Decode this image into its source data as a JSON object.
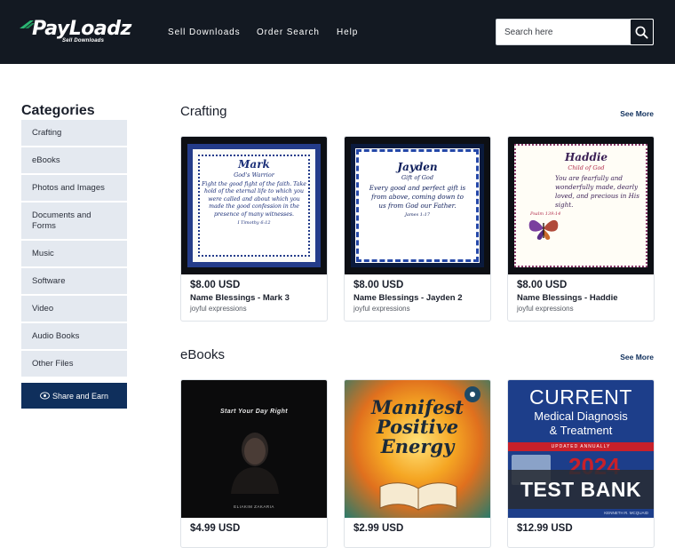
{
  "header": {
    "logo_text": "PayLoadz",
    "logo_sub": "Sell Downloads",
    "nav": [
      "Sell Downloads",
      "Order Search",
      "Help"
    ],
    "search_placeholder": "Search here"
  },
  "sidebar": {
    "title": "Categories",
    "items": [
      "Crafting",
      "eBooks",
      "Photos and Images",
      "Documents and Forms",
      "Music",
      "Software",
      "Video",
      "Audio Books",
      "Other Files"
    ],
    "share_label": "Share and Earn"
  },
  "sections": [
    {
      "title": "Crafting",
      "see_more": "See More",
      "cards": [
        {
          "price": "$8.00 USD",
          "name": "Name Blessings - Mark 3",
          "seller": "joyful expressions",
          "art": {
            "name": "Mark",
            "sub": "God's Warrior",
            "body": "Fight the good fight of the faith. Take hold of the eternal life to which you were called and about which you made the good confession in the presence of many witnesses.",
            "ref": "I Timothy 6:12"
          }
        },
        {
          "price": "$8.00 USD",
          "name": "Name Blessings - Jayden 2",
          "seller": "joyful expressions",
          "art": {
            "name": "Jayden",
            "sub": "Gift of God",
            "body": "Every good and perfect gift is from above, coming down to us from God our Father.",
            "ref": "James 1:17"
          }
        },
        {
          "price": "$8.00 USD",
          "name": "Name Blessings - Haddie",
          "seller": "joyful expressions",
          "art": {
            "name": "Haddie",
            "sub": "Child of God",
            "body": "You are fearfully and wonderfully made, dearly loved, and precious in His sight.",
            "ref": "Psalm 139:14"
          }
        }
      ]
    },
    {
      "title": "eBooks",
      "see_more": "See More",
      "cards": [
        {
          "price": "$4.99 USD",
          "art": {
            "title": "Start Your Day Right",
            "author": "ELIAKIM ZAKARIA"
          }
        },
        {
          "price": "$2.99 USD",
          "art": {
            "title": "Manifest Positive Energy"
          }
        },
        {
          "price": "$12.99 USD",
          "art": {
            "title1": "CURRENT",
            "title2": "Medical Diagnosis",
            "title3": "& Treatment",
            "updated": "UPDATED ANNUALLY",
            "year": "2024",
            "stamp": "TEST BANK",
            "author": "KENNETH R. MCQUAID"
          }
        }
      ]
    }
  ],
  "colors": {
    "header_bg": "#131922",
    "sidebar_item_bg": "#e4e9f0",
    "accent_navy": "#0f2f5c"
  }
}
